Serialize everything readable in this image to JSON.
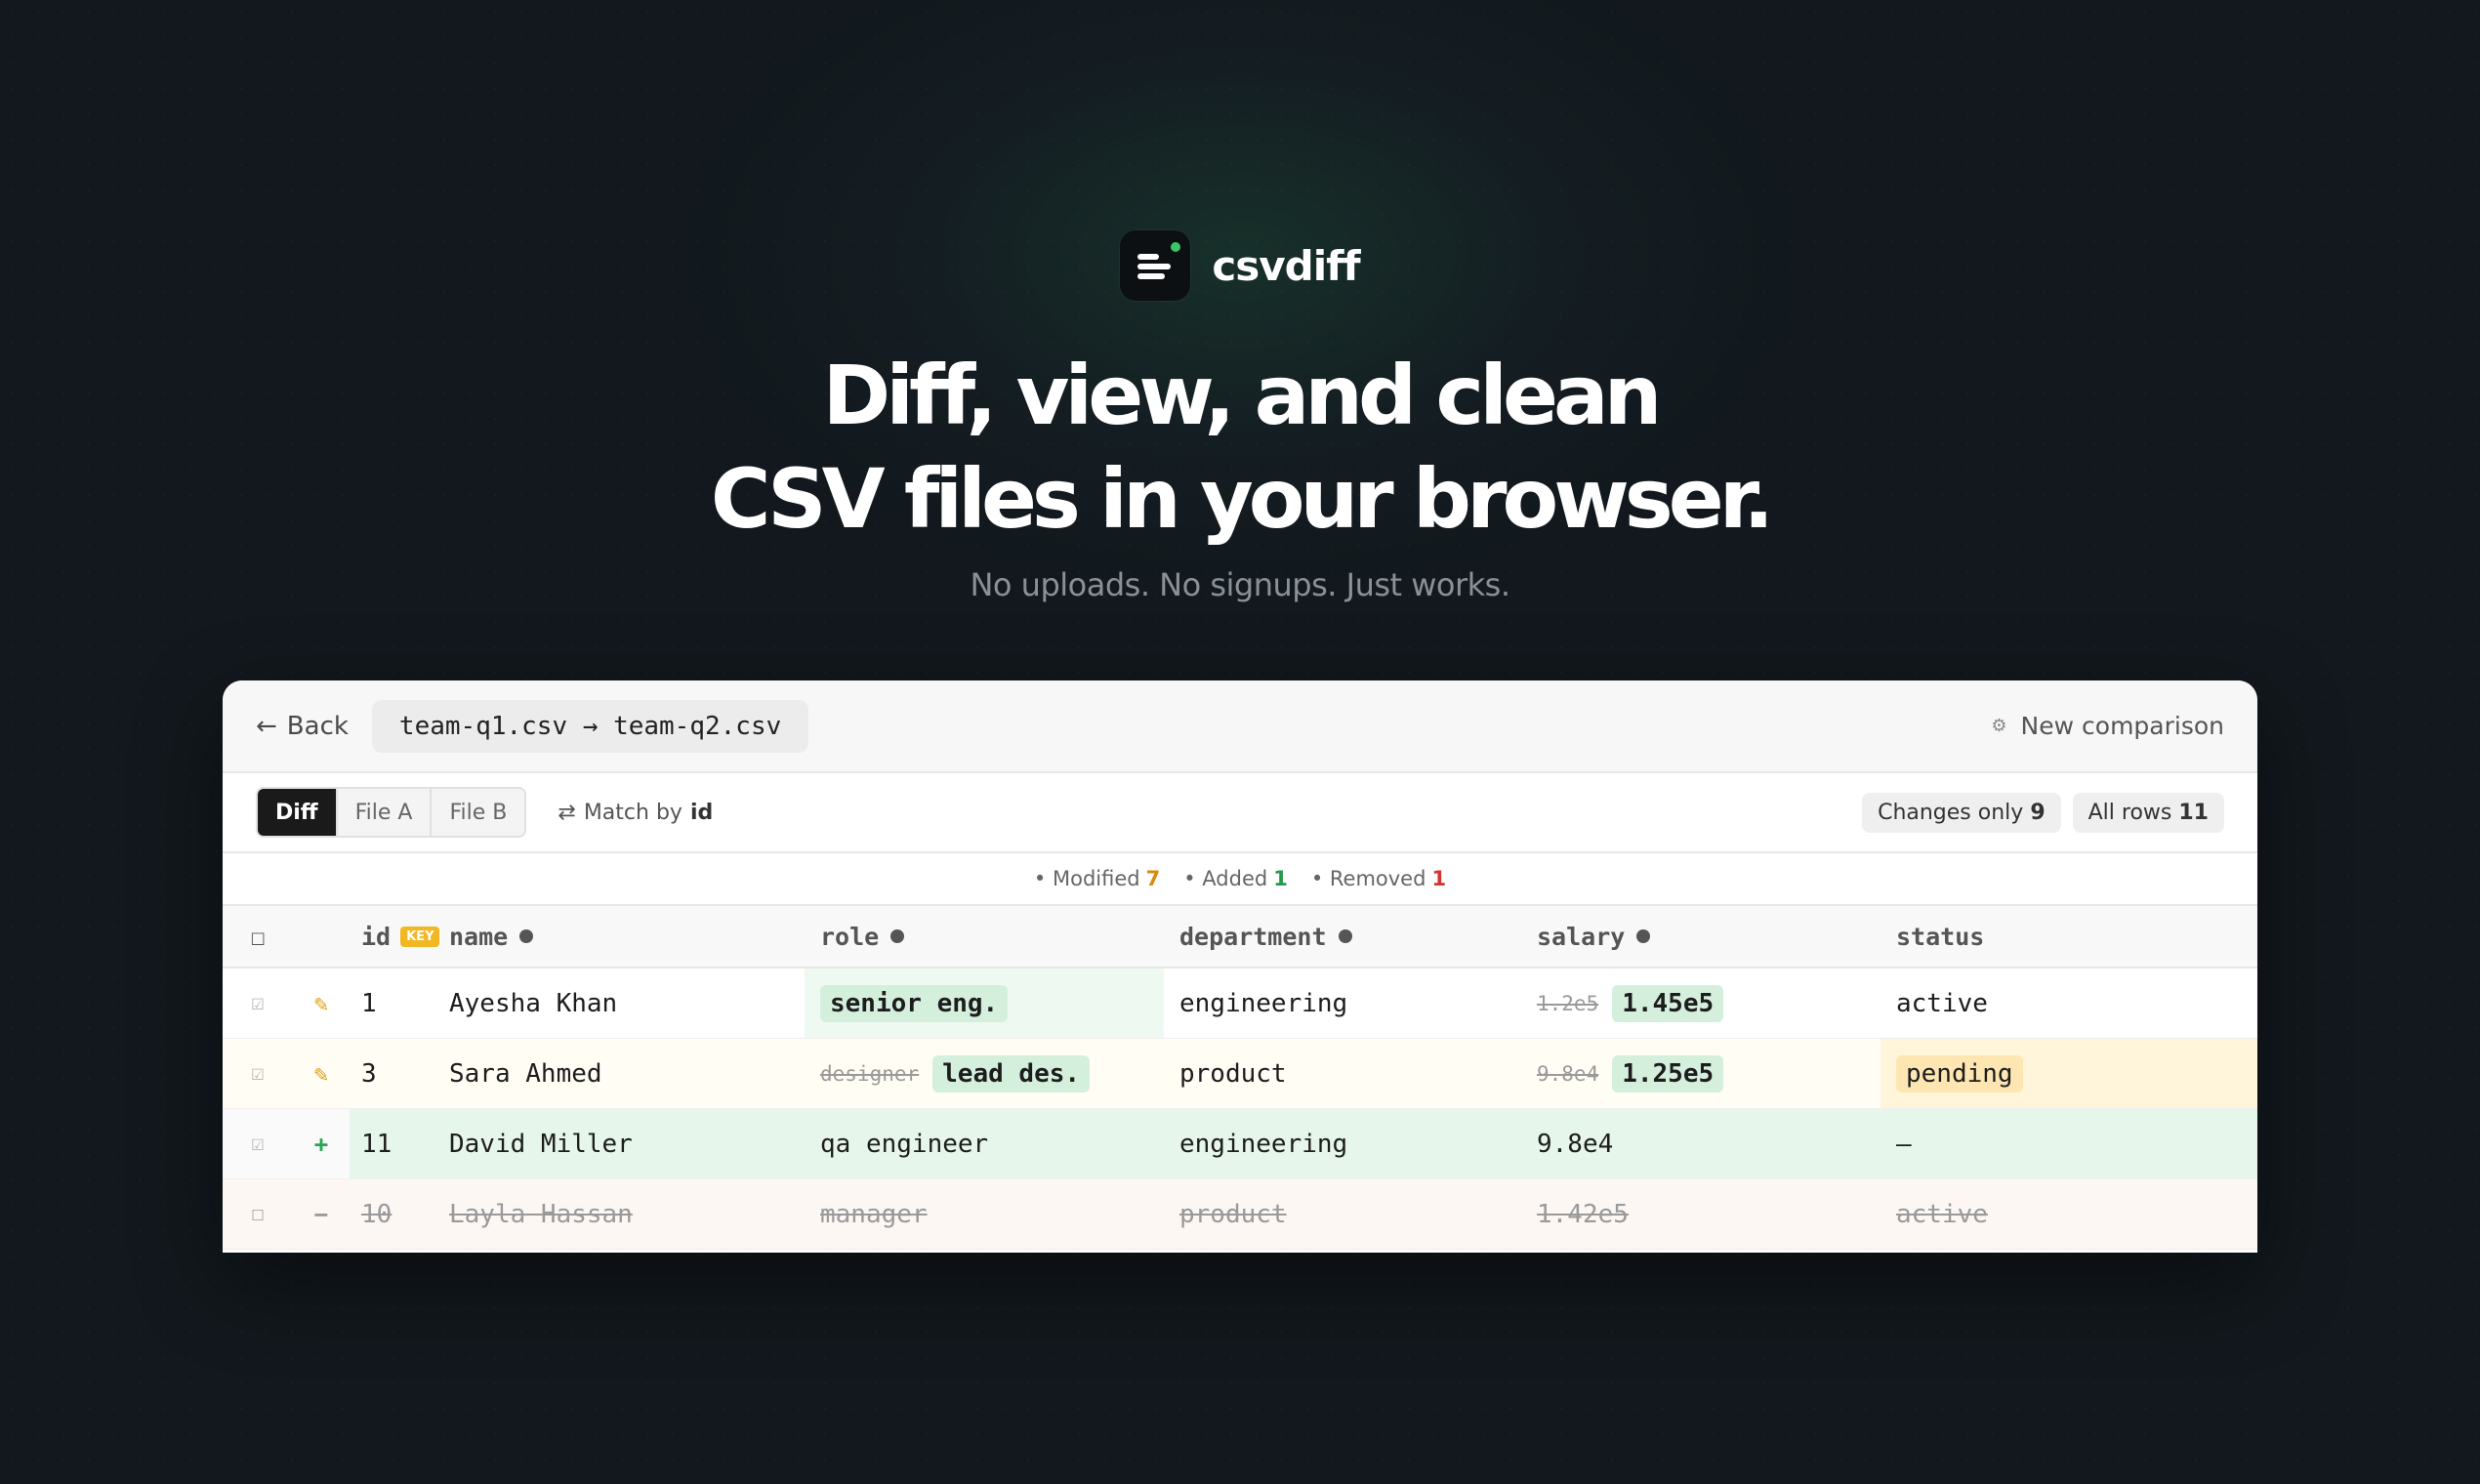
{
  "brand": {
    "name": "csvdiff"
  },
  "hero": {
    "line1": "Diff, view, and clean",
    "line2": "CSV files in your browser.",
    "subline": "No uploads. No signups. Just works."
  },
  "topbar": {
    "back_label": "Back",
    "back_arrow": "←",
    "files": "team-q1.csv → team-q2.csv",
    "new_comparison": "New comparison",
    "gear": "⚙"
  },
  "toolbar": {
    "views": [
      "Diff",
      "File A",
      "File B"
    ],
    "active_view": "Diff",
    "match_prefix": "Match by",
    "match_key": "id",
    "match_icon": "⇄",
    "changes_only_label": "Changes only",
    "changes_only_count": "9",
    "all_rows_label": "All rows",
    "all_rows_count": "11"
  },
  "summary": {
    "modified_label": "• Modified",
    "modified_count": "7",
    "added_label": "• Added",
    "added_count": "1",
    "removed_label": "• Removed",
    "removed_count": "1"
  },
  "table": {
    "headers": {
      "check": "☐",
      "id": "id",
      "key_badge": "KEY",
      "name": "name",
      "role": "role",
      "department": "department",
      "salary": "salary",
      "status": "status"
    },
    "rows": [
      {
        "check": "☑",
        "mark": "✎",
        "id": "1",
        "name": "Ayesha Khan",
        "role_old": "",
        "role": "senior eng.",
        "department": "engineering",
        "salary_old": "1.2e5",
        "salary": "1.45e5",
        "status": "active"
      },
      {
        "check": "☑",
        "mark": "✎",
        "id": "3",
        "name": "Sara Ahmed",
        "role_old": "designer",
        "role": "lead des.",
        "department": "product",
        "salary_old": "9.8e4",
        "salary": "1.25e5",
        "status": "pending"
      },
      {
        "check": "☑",
        "mark": "+",
        "id": "11",
        "name": "David Miller",
        "role": "qa engineer",
        "department": "engineering",
        "salary": "9.8e4",
        "status": "—"
      },
      {
        "check": "☐",
        "mark": "−",
        "id": "10",
        "name": "Layla Hassan",
        "role": "manager",
        "department": "product",
        "salary": "1.42e5",
        "status": "active"
      }
    ]
  },
  "colors": {
    "modified": "#d88a12",
    "added": "#239a4b",
    "removed": "#d2372f",
    "brand_dot": "#3cc46a"
  }
}
